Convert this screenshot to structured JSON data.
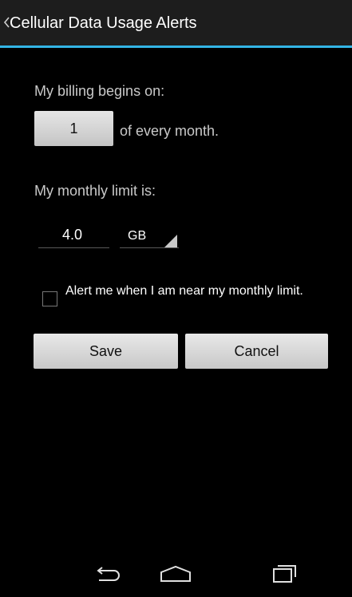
{
  "action_bar": {
    "title": "Cellular Data Usage Alerts",
    "accent_color": "#33b5e5",
    "back_icon": "chevron-left-icon"
  },
  "billing": {
    "label": "My billing begins on:",
    "day_value": "1",
    "suffix": "of every month."
  },
  "limit": {
    "label": "My monthly limit is:",
    "amount": "4.0",
    "unit": "GB"
  },
  "alert": {
    "checked": false,
    "label": "Alert me when I am near my monthly limit."
  },
  "buttons": {
    "save": "Save",
    "cancel": "Cancel"
  },
  "nav": {
    "back_icon": "back-arrow-icon",
    "home_icon": "home-icon",
    "recents_icon": "recent-apps-icon"
  }
}
